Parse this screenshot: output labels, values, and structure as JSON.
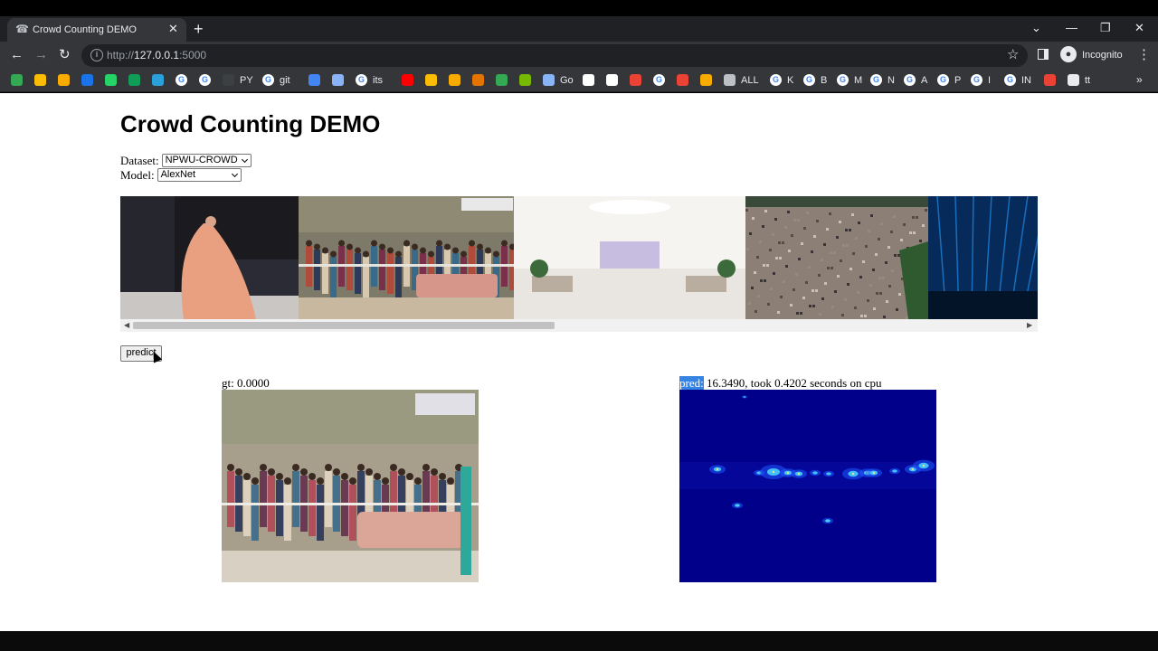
{
  "browser": {
    "tab": {
      "title": "Crowd Counting DEMO"
    },
    "address": {
      "scheme": "http://",
      "host": "127.0.0.1",
      "port": ":5000"
    },
    "profile_label": "Incognito",
    "bookmarks": [
      {
        "label": "",
        "icon": "bookmark-icon",
        "color": "#34a853"
      },
      {
        "label": "",
        "icon": "bookmark-icon",
        "color": "#fbbc04"
      },
      {
        "label": "",
        "icon": "chart-icon",
        "color": "#f9ab00"
      },
      {
        "label": "",
        "icon": "ieee-icon",
        "color": "#1a73e8"
      },
      {
        "label": "",
        "icon": "whatsapp-icon",
        "color": "#25d366"
      },
      {
        "label": "",
        "icon": "sheets-icon",
        "color": "#0f9d58"
      },
      {
        "label": "",
        "icon": "telegram-icon",
        "color": "#2aa1da"
      },
      {
        "label": "",
        "icon": "google-icon",
        "color": "#ffffff"
      },
      {
        "label": "",
        "icon": "google-icon",
        "color": "#ffffff"
      },
      {
        "label": "PY",
        "icon": "python-icon",
        "color": "#3c4043"
      },
      {
        "label": "git",
        "icon": "google-icon",
        "color": "#ffffff"
      },
      {
        "label": "",
        "icon": "docs-icon",
        "color": "#4285f4"
      },
      {
        "label": "",
        "icon": "car-icon",
        "color": "#8ab4f8"
      },
      {
        "label": "its",
        "icon": "google-icon",
        "color": "#ffffff"
      },
      {
        "label": "",
        "icon": "youtube-icon",
        "color": "#ff0000"
      },
      {
        "label": "",
        "icon": "p-icon",
        "color": "#fbbc04"
      },
      {
        "label": "",
        "icon": "bear-icon",
        "color": "#f9ab00"
      },
      {
        "label": "",
        "icon": "box-icon",
        "color": "#e37400"
      },
      {
        "label": "",
        "icon": "ring-icon",
        "color": "#34a853"
      },
      {
        "label": "",
        "icon": "nvidia-icon",
        "color": "#76b900"
      },
      {
        "label": "Go",
        "icon": "globe-icon",
        "color": "#8ab4f8"
      },
      {
        "label": "",
        "icon": "page-icon",
        "color": "#ffffff"
      },
      {
        "label": "",
        "icon": "cl-icon",
        "color": "#ffffff"
      },
      {
        "label": "",
        "icon": "ya-icon",
        "color": "#ea4335"
      },
      {
        "label": "",
        "icon": "google-icon",
        "color": "#ffffff"
      },
      {
        "label": "",
        "icon": "matlab-icon",
        "color": "#ea4335"
      },
      {
        "label": "",
        "icon": "diamond-icon",
        "color": "#f9ab00"
      },
      {
        "label": "ALL",
        "icon": "globe-icon",
        "color": "#bdc1c6"
      },
      {
        "label": "K",
        "icon": "google-icon",
        "color": "#ffffff"
      },
      {
        "label": "B",
        "icon": "google-icon",
        "color": "#ffffff"
      },
      {
        "label": "M",
        "icon": "google-icon",
        "color": "#ffffff"
      },
      {
        "label": "N",
        "icon": "google-icon",
        "color": "#ffffff"
      },
      {
        "label": "A",
        "icon": "google-icon",
        "color": "#ffffff"
      },
      {
        "label": "P",
        "icon": "google-icon",
        "color": "#ffffff"
      },
      {
        "label": "I",
        "icon": "google-icon",
        "color": "#ffffff"
      },
      {
        "label": "IN",
        "icon": "google-icon",
        "color": "#ffffff"
      },
      {
        "label": "",
        "icon": "pdf-icon",
        "color": "#ea4335"
      },
      {
        "label": "tt",
        "icon": "monitor-icon",
        "color": "#e8eaed"
      }
    ]
  },
  "page": {
    "title": "Crowd Counting DEMO",
    "dataset": {
      "label": "Dataset:",
      "value": "NPWU-CROWD"
    },
    "model": {
      "label": "Model:",
      "value": "AlexNet"
    },
    "gallery": [
      {
        "name": "runway-image",
        "subject": "fashion runway model",
        "colors": [
          "#1a1a1f",
          "#e8a080",
          "#2b2b36"
        ]
      },
      {
        "name": "street-crowd-image",
        "subject": "street queue crowd",
        "colors": [
          "#7e7a6a",
          "#b04a3a",
          "#c9b8a0"
        ]
      },
      {
        "name": "hall-image",
        "subject": "empty banquet hall",
        "colors": [
          "#e9e6e2",
          "#b8ad9e",
          "#f6f4f1"
        ]
      },
      {
        "name": "stadium-image",
        "subject": "stadium crowd",
        "colors": [
          "#3a4a3a",
          "#8c7f76",
          "#2f5a30"
        ]
      },
      {
        "name": "concert-image",
        "subject": "concert lights",
        "colors": [
          "#062a5a",
          "#1b7fd6",
          "#031428"
        ]
      }
    ],
    "scroll_fraction_visible": 0.46,
    "predict_label": "predict",
    "gt_caption": "gt: 0.0000",
    "pred_label": "pred:",
    "pred_rest": " 16.3490, took 0.4202 seconds on cpu",
    "colors": {
      "density_bg": "#00008a",
      "highlight": "#3584e4"
    }
  }
}
